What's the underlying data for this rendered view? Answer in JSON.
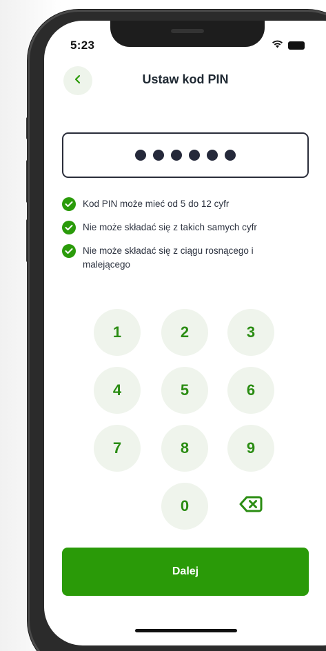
{
  "status_bar": {
    "time": "5:23",
    "icons": [
      "wifi-icon",
      "battery-icon"
    ]
  },
  "header": {
    "title": "Ustaw kod PIN",
    "back_icon": "chevron-left-icon"
  },
  "pin": {
    "entered_digits_count": 6,
    "mask_char": "●"
  },
  "rules": [
    {
      "text": "Kod PIN może mieć od 5 do 12 cyfr",
      "satisfied": true
    },
    {
      "text": "Nie może składać się z takich samych cyfr",
      "satisfied": true
    },
    {
      "text": "Nie może składać się z ciągu rosnącego i malejącego",
      "satisfied": true
    }
  ],
  "keypad": {
    "keys": [
      "1",
      "2",
      "3",
      "4",
      "5",
      "6",
      "7",
      "8",
      "9",
      "0"
    ],
    "delete_icon": "backspace-icon"
  },
  "actions": {
    "next_label": "Dalej"
  },
  "colors": {
    "accent": "#2a9a08",
    "key_bg": "#eff4ec",
    "text_dark": "#1f2933"
  }
}
